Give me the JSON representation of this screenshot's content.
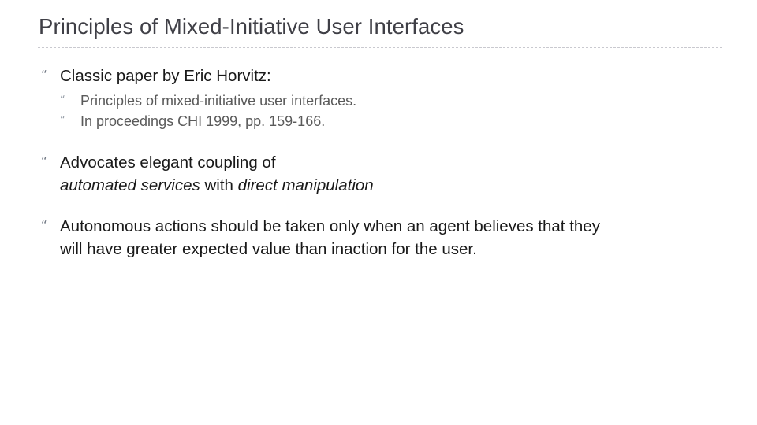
{
  "slide": {
    "title": "Principles of Mixed-Initiative User Interfaces",
    "bullet_glyph": "“",
    "colors": {
      "background": "#ffffff",
      "title": "#3f3f46",
      "level1_text": "#191919",
      "level2_text": "#5a5a5a",
      "level1_bullet": "#6e7682",
      "level2_bullet": "#9aa1ab",
      "divider": "#c9c9cf"
    },
    "bullets": [
      {
        "level": 1,
        "text": "Classic paper by Eric Horvitz:",
        "children": [
          {
            "level": 2,
            "text": "Principles of mixed-initiative user interfaces."
          },
          {
            "level": 2,
            "text": "In proceedings CHI 1999, pp. 159-166."
          }
        ]
      },
      {
        "level": 1,
        "line1": "Advocates elegant coupling of",
        "line2_part1": "automated services",
        "line2_part2": " with ",
        "line2_part3": "direct manipulation"
      },
      {
        "level": 1,
        "line1": "Autonomous actions should be taken only when an agent believes that they",
        "line2": "will have greater expected value than inaction for the user."
      }
    ]
  }
}
